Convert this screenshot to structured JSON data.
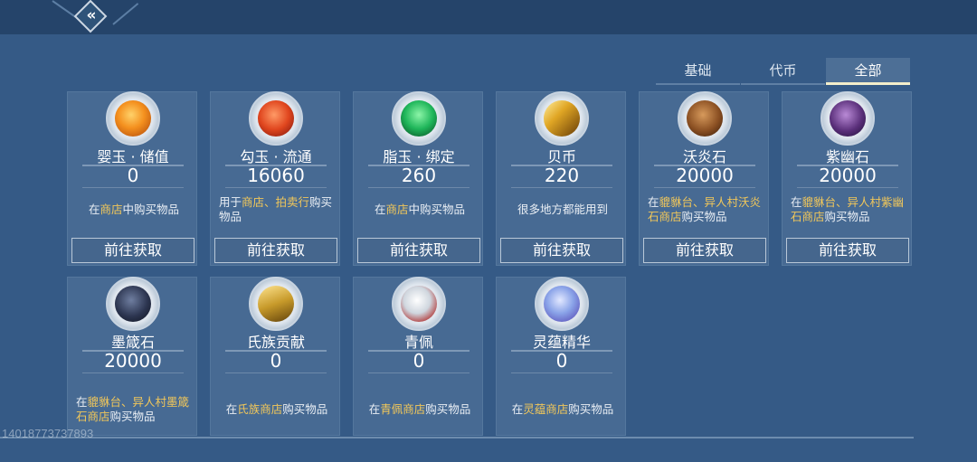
{
  "header": {
    "back_icon": "back-arrow-icon"
  },
  "tabs": [
    {
      "label": "基础",
      "active": false
    },
    {
      "label": "代币",
      "active": false
    },
    {
      "label": "全部",
      "active": true
    }
  ],
  "items": [
    {
      "name": "婴玉 · 储值",
      "count": "0",
      "desc_pre": "在",
      "desc_hl": "商店",
      "desc_post": "中购买物品",
      "button": "前往获取",
      "icon": "orange-jade-icon"
    },
    {
      "name": "勾玉 · 流通",
      "count": "16060",
      "desc_pre": "用于",
      "desc_hl": "商店、拍卖行",
      "desc_post": "购买物品",
      "button": "前往获取",
      "icon": "red-swirl-jade-icon"
    },
    {
      "name": "脂玉 · 绑定",
      "count": "260",
      "desc_pre": "在",
      "desc_hl": "商店",
      "desc_post": "中购买物品",
      "button": "前往获取",
      "icon": "green-jade-icon"
    },
    {
      "name": "贝币",
      "count": "220",
      "desc_pre": "很多地方都能用到",
      "desc_hl": "",
      "desc_post": "",
      "button": "前往获取",
      "icon": "shell-coin-icon"
    },
    {
      "name": "沃炎石",
      "count": "20000",
      "desc_pre": "在",
      "desc_hl": "貔貅台、异人村沃炎石商店",
      "desc_post": "购买物品",
      "button": "前往获取",
      "icon": "flame-stone-icon"
    },
    {
      "name": "紫幽石",
      "count": "20000",
      "desc_pre": "在",
      "desc_hl": "貔貅台、异人村紫幽石商店",
      "desc_post": "购买物品",
      "button": "前往获取",
      "icon": "purple-stone-icon"
    },
    {
      "name": "墨箴石",
      "count": "20000",
      "desc_pre": "在",
      "desc_hl": "貔貅台、异人村墨箴石商店",
      "desc_post": "购买物品",
      "icon": "ink-stone-icon"
    },
    {
      "name": "氏族贡献",
      "count": "0",
      "desc_pre": "在",
      "desc_hl": "氏族商店",
      "desc_post": "购买物品",
      "icon": "clan-coin-icon"
    },
    {
      "name": "青佩",
      "count": "0",
      "desc_pre": "在",
      "desc_hl": "青佩商店",
      "desc_post": "购买物品",
      "icon": "jade-pendant-icon"
    },
    {
      "name": "灵蕴精华",
      "count": "0",
      "desc_pre": "在",
      "desc_hl": "灵蕴商店",
      "desc_post": "购买物品",
      "icon": "spirit-essence-icon"
    }
  ],
  "watermark": "14018773737893",
  "colors": {
    "background": "#355a86",
    "card": "#476a93",
    "highlight": "#f1c75a"
  }
}
